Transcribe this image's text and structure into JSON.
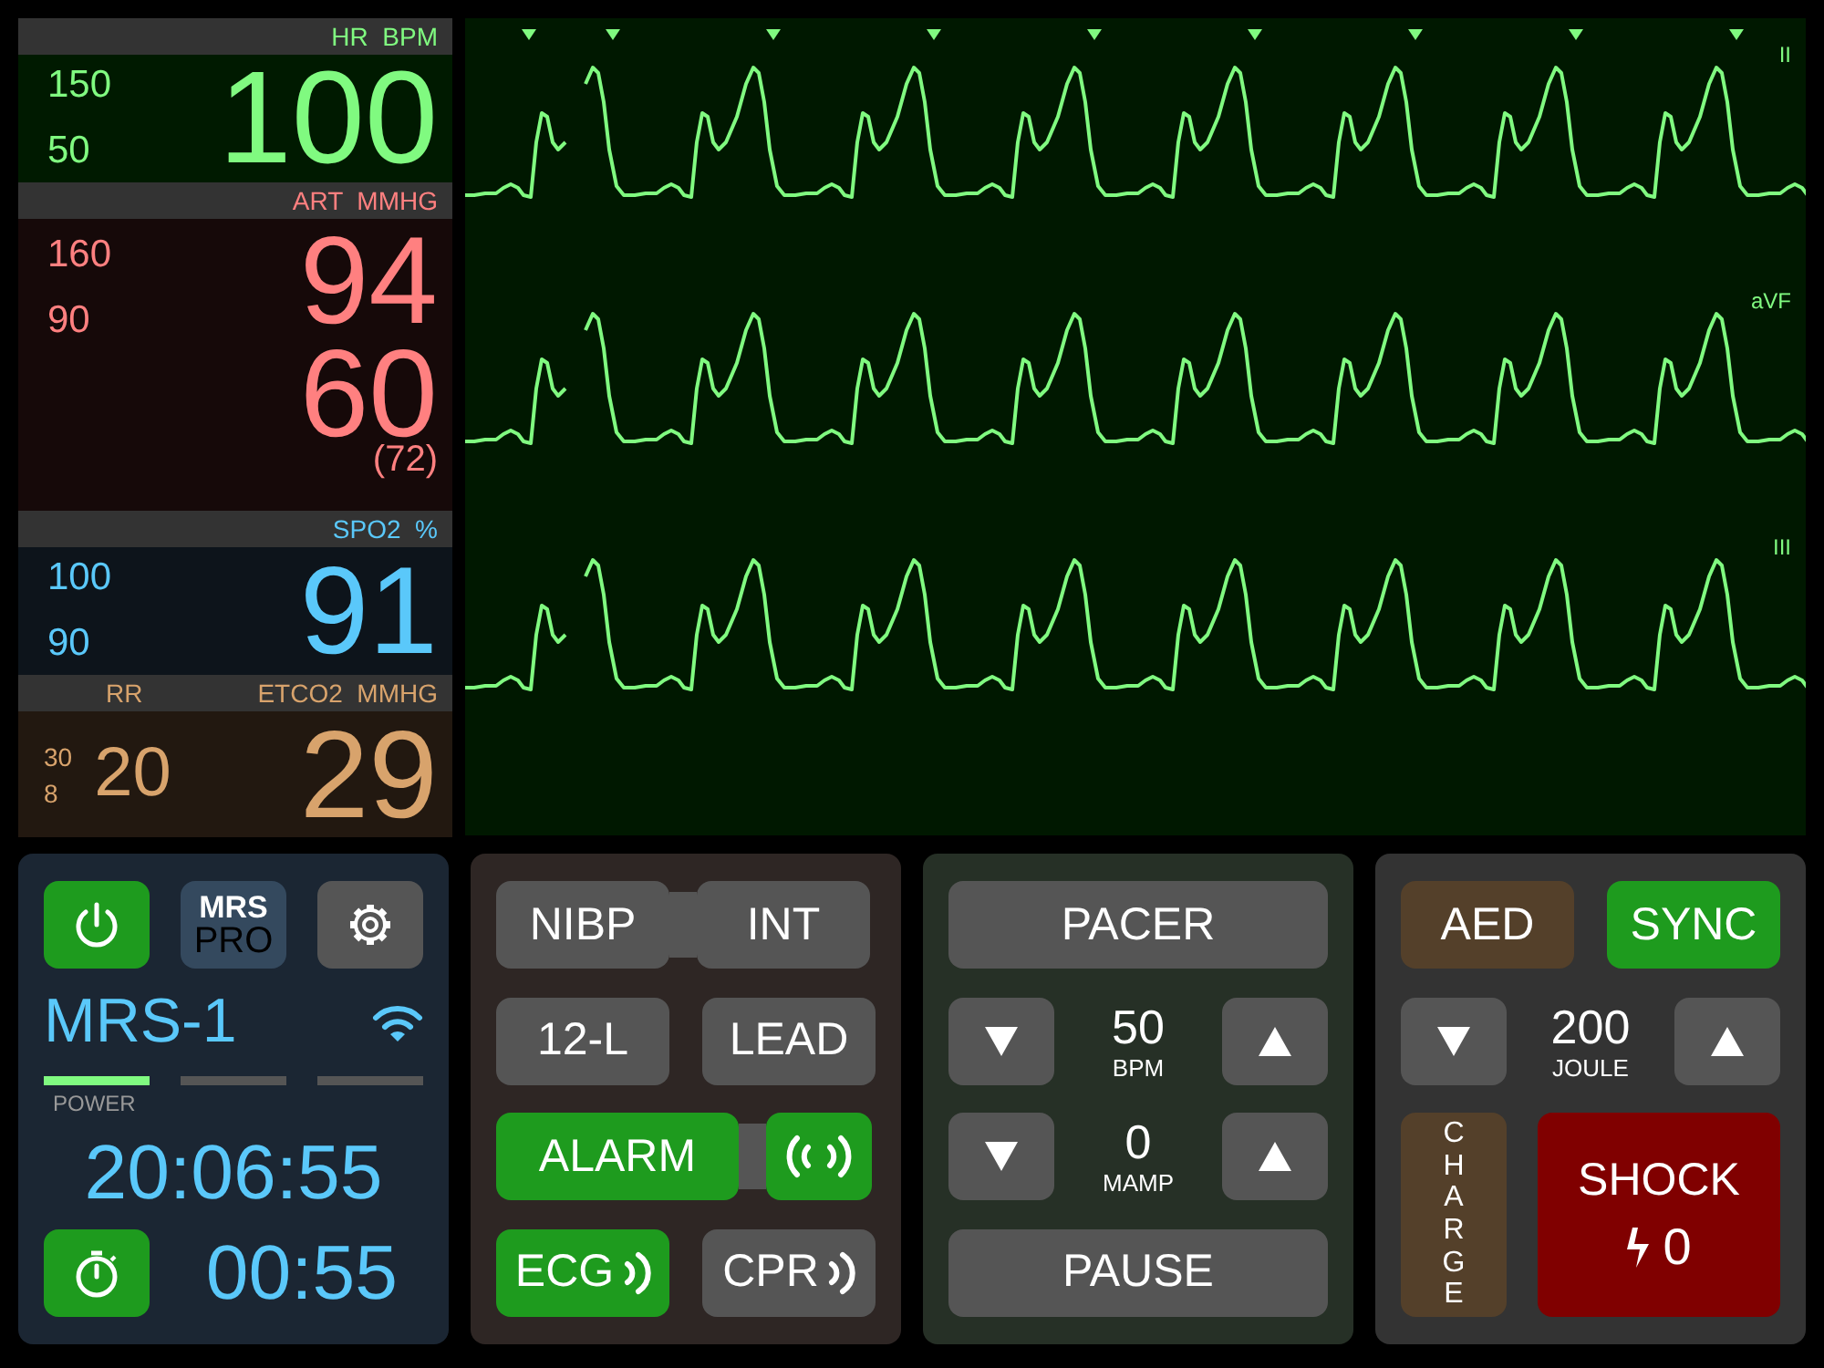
{
  "vitals": [
    {
      "kind": "hr",
      "label": "HR  BPM",
      "high": "150",
      "low": "50",
      "value": "100",
      "color": "#80fa80"
    },
    {
      "kind": "art",
      "label": "ART  MMHG",
      "high": "160",
      "low": "90",
      "systolic": "94",
      "diastolic": "60",
      "mean": "(72)",
      "color": "#ff8080"
    },
    {
      "kind": "spo2",
      "label": "SPO2  %",
      "high": "100",
      "low": "90",
      "value": "91",
      "color": "#5ac8fa"
    },
    {
      "kind": "resp",
      "rr_label": "RR",
      "label": "ETCO2  MMHG",
      "high": "30",
      "low": "8",
      "rr": "20",
      "value": "29",
      "color": "#d8a36c"
    }
  ],
  "leads": [
    {
      "label": "II"
    },
    {
      "label": "aVF"
    },
    {
      "label": "III"
    }
  ],
  "device": {
    "power_on": true,
    "logo_top": "MRS",
    "logo_bottom": "PRO",
    "name": "MRS-1",
    "indicators": [
      {
        "label": "POWER",
        "on": true
      },
      {
        "on": false
      },
      {
        "on": false
      }
    ],
    "clock": "20:06:55",
    "timer_on": true,
    "timer": "00:55"
  },
  "modes": {
    "nibp": {
      "label": "NIBP",
      "on": false
    },
    "int": {
      "label": "INT",
      "on": false
    },
    "twelve_lead": {
      "label": "12-L"
    },
    "lead": {
      "label": "LEAD"
    },
    "alarm": {
      "label": "ALARM",
      "on": true
    },
    "alarm_sound": {
      "on": true
    },
    "ecg_sound": {
      "label": "ECG",
      "on": true
    },
    "cpr_sound": {
      "label": "CPR",
      "on": false
    }
  },
  "pacer": {
    "label": "PACER",
    "rate": "50",
    "rate_unit": "BPM",
    "current": "0",
    "current_unit": "MAMP",
    "pause": "PAUSE"
  },
  "defib": {
    "aed": {
      "label": "AED",
      "on": false
    },
    "sync": {
      "label": "SYNC",
      "on": true
    },
    "energy": "200",
    "energy_unit": "JOULE",
    "charge": "CHARGE",
    "shock": "SHOCK",
    "shock_count": "0"
  }
}
